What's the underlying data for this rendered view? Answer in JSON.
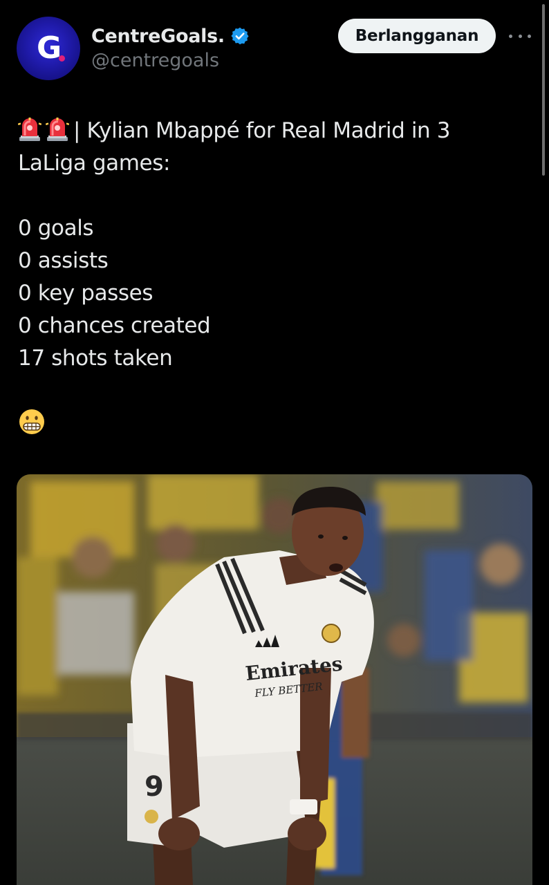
{
  "header": {
    "avatar_letter": "G",
    "display_name": "CentreGoals.",
    "handle": "@centregoals",
    "subscribe_label": "Berlangganan"
  },
  "tweet": {
    "headline_line1": "| Kylian Mbappé for Real Madrid in 3",
    "headline_line2": "LaLiga games:",
    "stats": [
      "0 goals",
      "0 assists",
      "0 key passes",
      "0 chances created",
      "17 shots taken"
    ],
    "emojis": {
      "siren": "siren-emoji",
      "grimace": "grimacing-face-emoji"
    }
  },
  "media": {
    "jersey_text_line1": "Emirates",
    "jersey_text_line2": "FLY BETTER",
    "shorts_number": "9"
  },
  "colors": {
    "background": "#000000",
    "text": "#e7e9ea",
    "muted": "#71767b",
    "verified_blue": "#1d9bf0",
    "button_bg": "#eff3f4"
  }
}
